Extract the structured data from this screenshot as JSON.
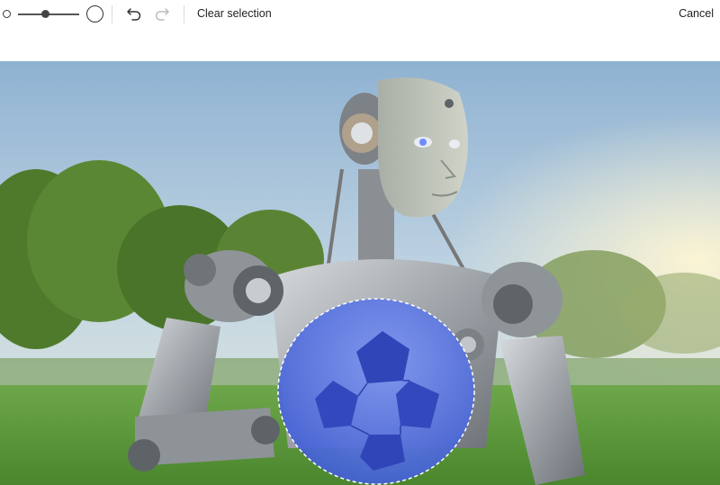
{
  "toolbar": {
    "brush_small_icon": "brush-size-small-icon",
    "brush_large_icon": "brush-size-large-icon",
    "brush_size_level": 0.45,
    "undo_icon": "undo-icon",
    "redo_icon": "redo-icon",
    "clear_label": "Clear selection",
    "cancel_label": "Cancel"
  },
  "canvas": {
    "image_subject": "robot-holding-soccer-ball",
    "selection_color": "#4f6fe0",
    "sky_color": "#9fbbd6",
    "grass_color": "#5e9a3a"
  }
}
